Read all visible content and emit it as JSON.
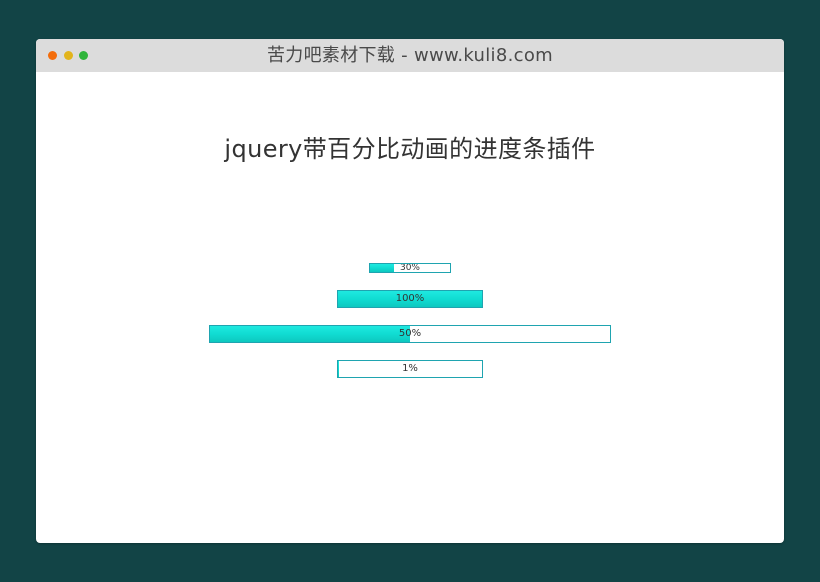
{
  "window": {
    "title": "苦力吧素材下载 - www.kuli8.com"
  },
  "main": {
    "heading": "jquery带百分比动画的进度条插件",
    "progress_bars": [
      {
        "label": "30%",
        "value": 30
      },
      {
        "label": "100%",
        "value": 100
      },
      {
        "label": "50%",
        "value": 50
      },
      {
        "label": "1%",
        "value": 1
      }
    ]
  },
  "colors": {
    "page_background": "#124446",
    "titlebar": "#dcdcdc",
    "bar_fill": "#10dcd2",
    "bar_border": "#1fa4b0",
    "dot_red": "#f36d0c",
    "dot_yellow": "#e2b41c",
    "dot_green": "#2fb43a"
  }
}
